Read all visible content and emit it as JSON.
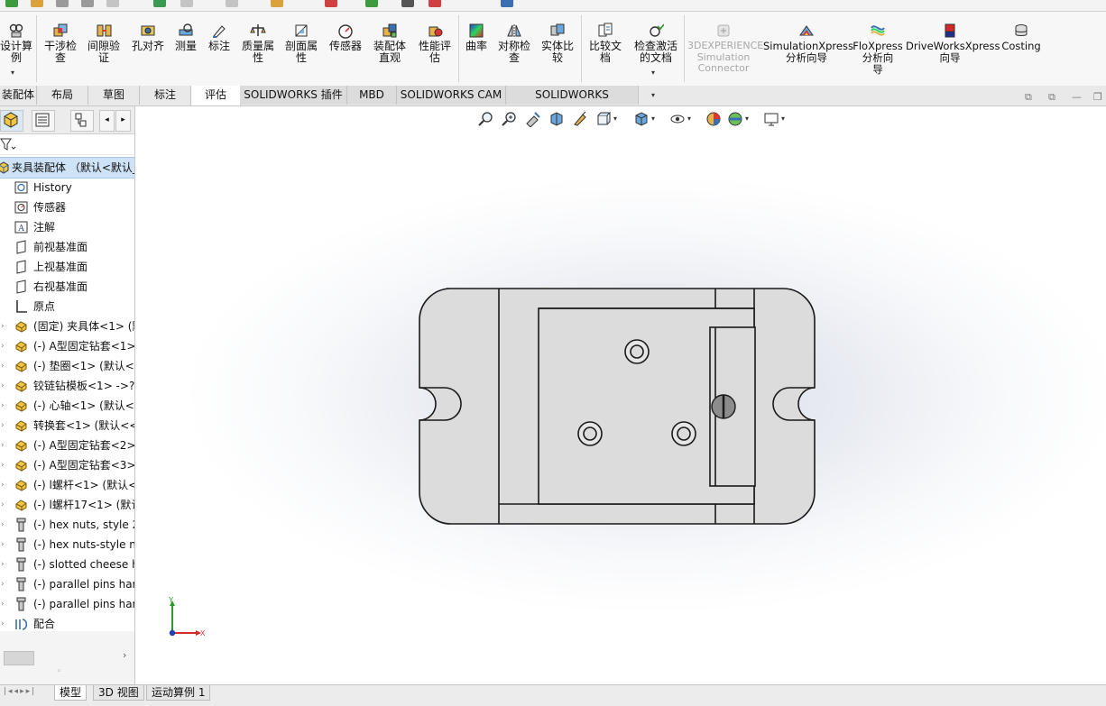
{
  "ribbon": {
    "buttons": [
      {
        "id": "design-study",
        "label": "设计算\n例",
        "icon": "design-study-icon"
      },
      {
        "id": "interference-check",
        "label": "干涉检\n查",
        "icon": "interference-icon"
      },
      {
        "id": "clearance-verification",
        "label": "间隙验\n证",
        "icon": "clearance-icon"
      },
      {
        "id": "hole-alignment",
        "label": "孔对齐",
        "icon": "hole-align-icon"
      },
      {
        "id": "measure",
        "label": "测量",
        "icon": "measure-icon"
      },
      {
        "id": "markup",
        "label": "标注",
        "icon": "markup-icon"
      },
      {
        "id": "mass-properties",
        "label": "质量属\n性",
        "icon": "mass-properties-icon"
      },
      {
        "id": "section-properties",
        "label": "剖面属\n性",
        "icon": "section-properties-icon"
      },
      {
        "id": "sensor",
        "label": "传感器",
        "icon": "sensor-icon"
      },
      {
        "id": "assembly-visualization",
        "label": "装配体\n直观",
        "icon": "assembly-visualization-icon"
      },
      {
        "id": "performance-evaluation",
        "label": "性能评\n估",
        "icon": "performance-icon"
      },
      {
        "id": "curvature",
        "label": "曲率",
        "icon": "curvature-icon"
      },
      {
        "id": "symmetry-check",
        "label": "对称检\n查",
        "icon": "symmetry-icon"
      },
      {
        "id": "compare-geometry",
        "label": "实体比\n较",
        "icon": "compare-geometry-icon"
      },
      {
        "id": "compare-documents",
        "label": "比较文\n档",
        "icon": "compare-documents-icon"
      },
      {
        "id": "check-active-document",
        "label": "检查激活\n的文档",
        "icon": "check-document-icon"
      },
      {
        "id": "3dexperience-simulation",
        "label": "3DEXPERIENCE\nSimulation\nConnector",
        "icon": "3dexperience-icon"
      },
      {
        "id": "simulationxpress",
        "label": "SimulationXpress\n分析向导",
        "icon": "simulationxpress-icon"
      },
      {
        "id": "floxpress",
        "label": "FloXpress\n分析向\n导",
        "icon": "floxpress-icon"
      },
      {
        "id": "driveworksxpress",
        "label": "DriveWorksXpress\n向导",
        "icon": "driveworksxpress-icon"
      },
      {
        "id": "costing",
        "label": "Costing",
        "icon": "costing-icon"
      }
    ]
  },
  "tabs": [
    {
      "label": "装配体"
    },
    {
      "label": "布局"
    },
    {
      "label": "草图"
    },
    {
      "label": "标注"
    },
    {
      "label": "评估",
      "active": true
    },
    {
      "label": "SOLIDWORKS 插件"
    },
    {
      "label": "MBD"
    },
    {
      "label": "SOLIDWORKS CAM"
    },
    {
      "label": "SOLIDWORKS Inspection"
    }
  ],
  "tree": {
    "root": "夹具装配体 （默认<默认_",
    "items": [
      {
        "label": "History",
        "icon": "history-icon"
      },
      {
        "label": "传感器",
        "icon": "sensor-folder-icon"
      },
      {
        "label": "注解",
        "icon": "annotation-icon"
      },
      {
        "label": "前视基准面",
        "icon": "plane-icon"
      },
      {
        "label": "上视基准面",
        "icon": "plane-icon"
      },
      {
        "label": "右视基准面",
        "icon": "plane-icon"
      },
      {
        "label": "原点",
        "icon": "origin-icon"
      },
      {
        "label": "(固定) 夹具体<1> (默",
        "icon": "part-icon"
      },
      {
        "label": "(-) A型固定钻套<1>",
        "icon": "part-icon"
      },
      {
        "label": "(-) 垫圈<1> (默认<",
        "icon": "part-icon"
      },
      {
        "label": "铰链钻模板<1> ->?",
        "icon": "part-icon"
      },
      {
        "label": "(-) 心轴<1> (默认<",
        "icon": "part-icon"
      },
      {
        "label": "转换套<1> (默认<<",
        "icon": "part-icon"
      },
      {
        "label": "(-) A型固定钻套<2>",
        "icon": "part-icon"
      },
      {
        "label": "(-) A型固定钻套<3>",
        "icon": "part-icon"
      },
      {
        "label": "(-) l螺杆<1> (默认<",
        "icon": "part-icon"
      },
      {
        "label": "(-) l螺杆17<1> (默认",
        "icon": "part-icon"
      },
      {
        "label": "(-) hex nuts, style 2",
        "icon": "toolbox-part-icon"
      },
      {
        "label": "(-) hex nuts-style nc",
        "icon": "toolbox-part-icon"
      },
      {
        "label": "(-) slotted cheese h",
        "icon": "toolbox-part-icon"
      },
      {
        "label": "(-) parallel pins har",
        "icon": "toolbox-part-icon"
      },
      {
        "label": "(-) parallel pins har",
        "icon": "toolbox-part-icon"
      },
      {
        "label": "配合",
        "icon": "mates-icon"
      }
    ]
  },
  "triad": {
    "x_label": "X",
    "y_label": "Y"
  },
  "bottom_tabs": [
    {
      "label": "模型",
      "active": true
    },
    {
      "label": "3D 视图"
    },
    {
      "label": "运动算例 1"
    }
  ],
  "colors": {
    "accent": "#1f6fc6",
    "tab_active": "#ffffff",
    "panel_line": "#1f6fc6",
    "part_fill": "#dcdcdc",
    "edge": "#1a1a1a"
  }
}
